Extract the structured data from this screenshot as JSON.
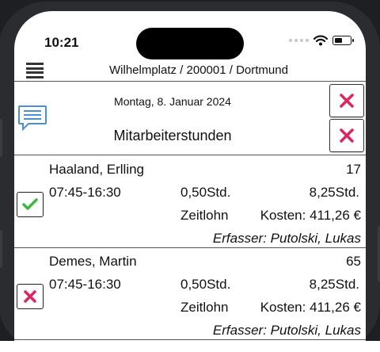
{
  "status_bar": {
    "time": "10:21"
  },
  "header": {
    "location": "Wilhelmplatz  / 200001 / Dortmund",
    "date": "Montag, 8. Januar 2024",
    "title": "Mitarbeiterstunden"
  },
  "entries": [
    {
      "name": "Haaland, Erlling",
      "number": "17",
      "times": "07:45-16:30",
      "break": "0,50Std.",
      "hours": "8,25Std.",
      "wage_type": "Zeitlohn",
      "cost": "Kosten: 411,26 €",
      "author": "Erfasser: Putolski, Lukas",
      "status": "approved"
    },
    {
      "name": "Demes, Martin",
      "number": "65",
      "times": "07:45-16:30",
      "break": "0,50Std.",
      "hours": "8,25Std.",
      "wage_type": "Zeitlohn",
      "cost": "Kosten: 411,26 €",
      "author": "Erfasser: Putolski, Lukas",
      "status": "rejected"
    }
  ],
  "colors": {
    "check_green": "#3cb83c",
    "reject_red": "#e0245e",
    "chat_blue": "#4a90d9"
  },
  "icons": [
    "menu-icon",
    "chat-icon",
    "close-icon",
    "checkmark-icon",
    "wifi-icon",
    "battery-icon"
  ]
}
